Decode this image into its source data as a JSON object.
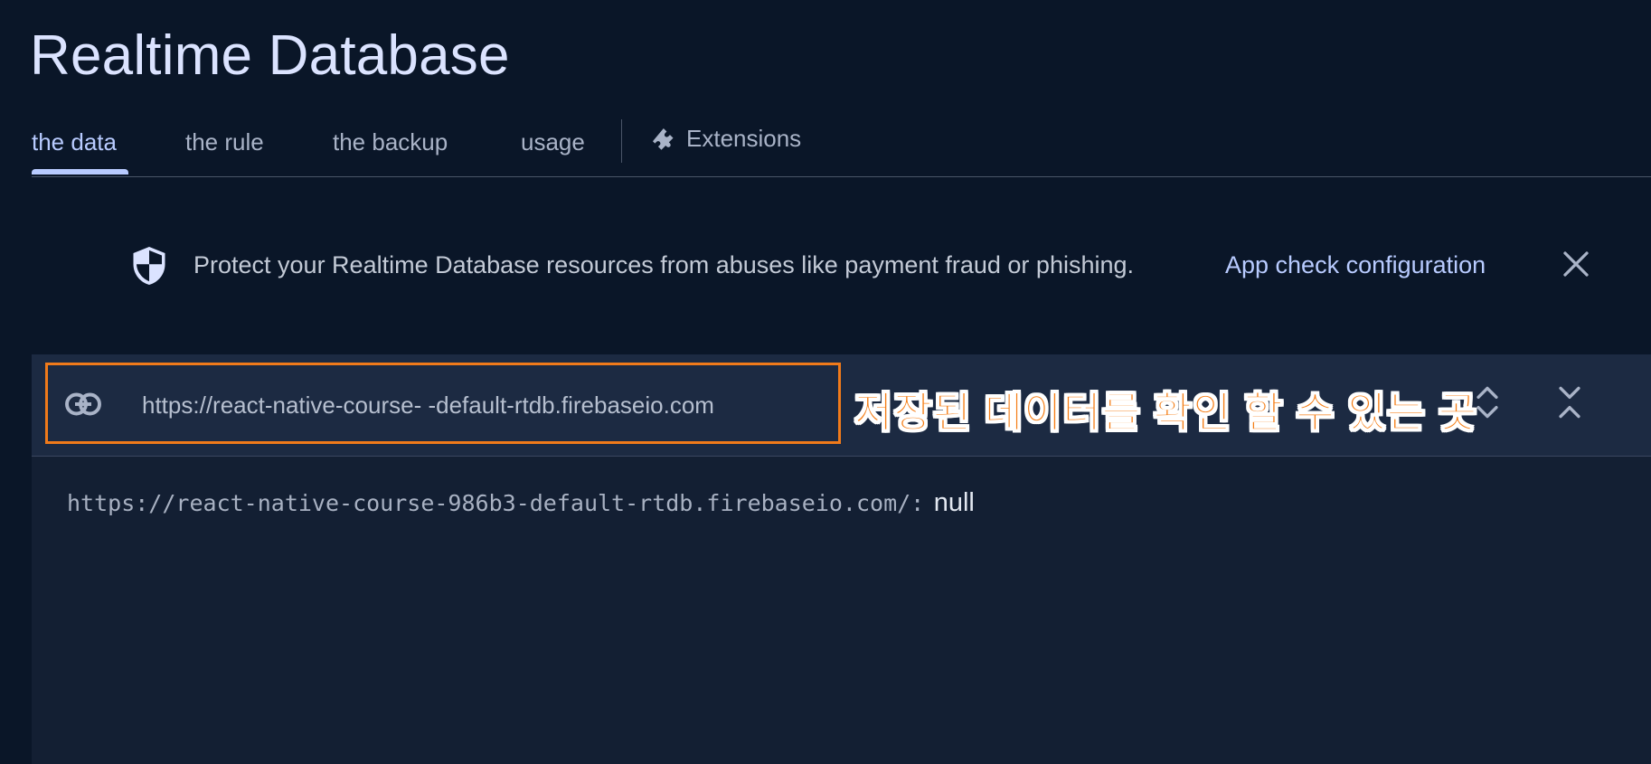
{
  "page": {
    "title": "Realtime Database"
  },
  "tabs": [
    {
      "label": "the data",
      "active": true
    },
    {
      "label": "the rule",
      "active": false
    },
    {
      "label": "the backup",
      "active": false
    },
    {
      "label": "usage",
      "active": false
    },
    {
      "label": "Extensions",
      "icon": "extension-icon",
      "active": false
    }
  ],
  "banner": {
    "icon": "shield-icon",
    "message": "Protect your Realtime Database resources from abuses like payment fraud or phishing.",
    "link_label": "App check configuration",
    "close_icon": "close-icon"
  },
  "panel": {
    "url_icon": "link-icon",
    "url": "https://react-native-course-        -default-rtdb.firebaseio.com",
    "annotation": "저장된 데이터를 확인 할 수 있는 곳",
    "expand_icon": "expand-all-icon",
    "collapse_icon": "collapse-all-icon",
    "tree": {
      "path": "https://react-native-course-986b3-default-rtdb.firebaseio.com/:",
      "value": "null"
    }
  },
  "colors": {
    "background": "#0a1628",
    "panel": "#131f33",
    "panel_header": "#1c2a42",
    "accent": "#b8cbff",
    "highlight_border": "#f07a1a",
    "annotation": "#f57c13"
  }
}
